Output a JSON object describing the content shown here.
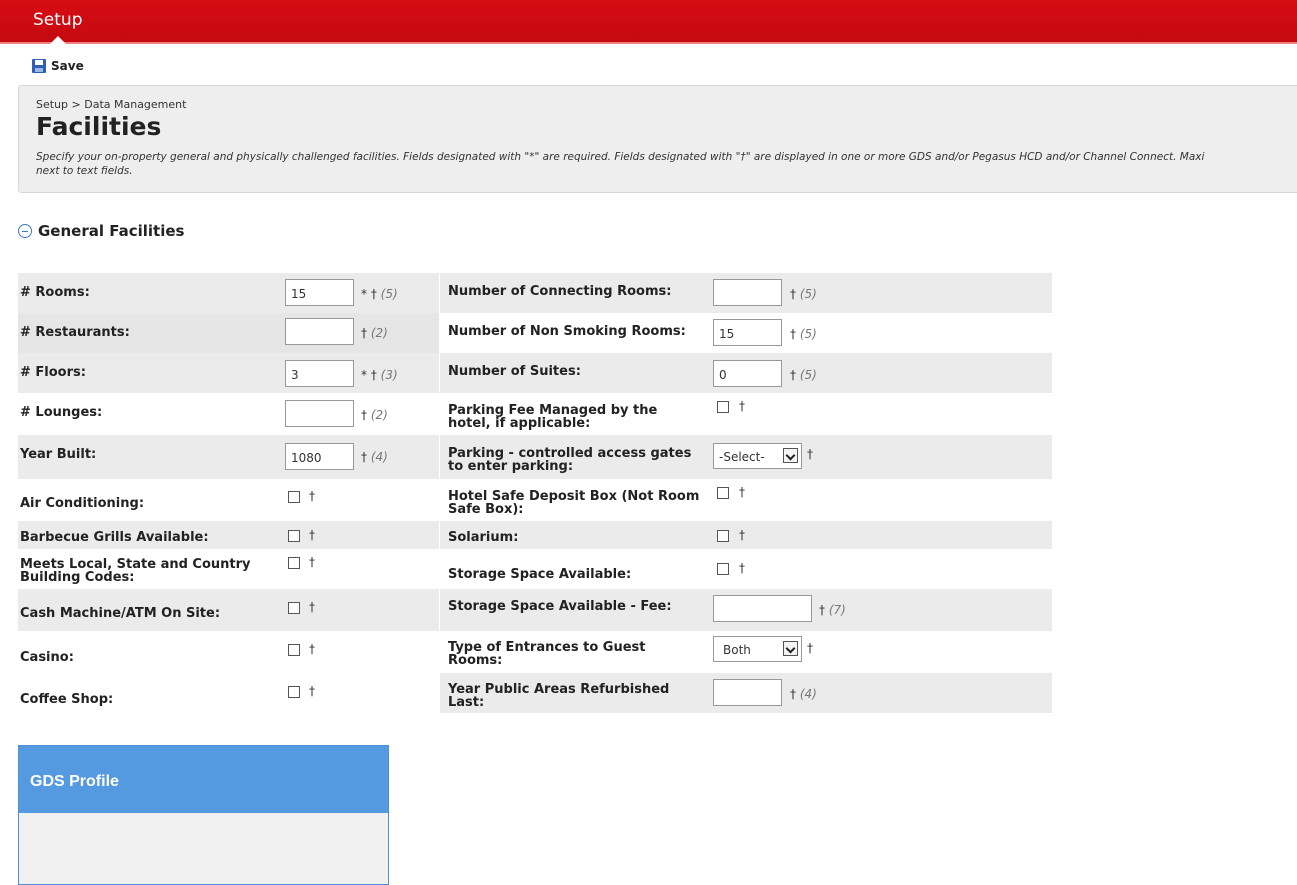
{
  "topbar": {
    "title": "Setup"
  },
  "toolbar": {
    "save_label": "Save"
  },
  "header": {
    "breadcrumb": "Setup > Data Management",
    "title": "Facilities",
    "description_line1": "Specify your on-property general and physically challenged facilities. Fields designated with \"*\" are required. Fields designated with \"†\" are displayed in one or more GDS and/or Pegasus HCD and/or Channel Connect. Maxi",
    "description_line2": "next to text fields."
  },
  "section": {
    "title": "General Facilities"
  },
  "left_fields": [
    {
      "label": "# Rooms:",
      "value": "15",
      "req": "* †",
      "max": "(5)"
    },
    {
      "label": "# Restaurants:",
      "value": "",
      "req": "†",
      "max": "(2)"
    },
    {
      "label": "# Floors:",
      "value": "3",
      "req": "* †",
      "max": "(3)"
    },
    {
      "label": "# Lounges:",
      "value": "",
      "req": "†",
      "max": "(2)"
    },
    {
      "label": "Year Built:",
      "value": "1080",
      "req": "†",
      "max": "(4)"
    },
    {
      "label": "Air Conditioning:",
      "req": "†"
    },
    {
      "label": "Barbecue Grills Available:",
      "req": "†"
    },
    {
      "label_line1": "Meets Local, State and Country",
      "label_line2": "Building Codes:",
      "req": "†"
    },
    {
      "label": "Cash Machine/ATM On Site:",
      "req": "†"
    },
    {
      "label": "Casino:",
      "req": "†"
    },
    {
      "label": "Coffee Shop:",
      "req": "†"
    }
  ],
  "right_fields": [
    {
      "label": "Number of Connecting Rooms:",
      "value": "",
      "req": "†",
      "max": "(5)"
    },
    {
      "label": "Number of Non Smoking Rooms:",
      "value": "15",
      "req": "†",
      "max": "(5)"
    },
    {
      "label": "Number of Suites:",
      "value": "0",
      "req": "†",
      "max": "(5)"
    },
    {
      "label_line1": "Parking Fee Managed by the",
      "label_line2": "hotel, if applicable:",
      "req": "†"
    },
    {
      "label_line1": "Parking - controlled access gates",
      "label_line2": "to enter parking:",
      "selected": "-Select-",
      "req": "†"
    },
    {
      "label_line1": "Hotel Safe Deposit Box (Not Room",
      "label_line2": "Safe Box):",
      "req": "†"
    },
    {
      "label": "Solarium:",
      "req": "†"
    },
    {
      "label": "Storage Space Available:",
      "req": "†"
    },
    {
      "label": "Storage Space Available - Fee:",
      "value": "",
      "req": "†",
      "max": "(7)"
    },
    {
      "label_line1": "Type of Entrances to Guest",
      "label_line2": "Rooms:",
      "selected": "Both",
      "req": "†"
    },
    {
      "label_line1": "Year Public Areas Refurbished",
      "label_line2": "Last:",
      "value": "",
      "req": "†",
      "max": "(4)"
    }
  ],
  "gds_panel": {
    "title": "GDS Profile"
  }
}
